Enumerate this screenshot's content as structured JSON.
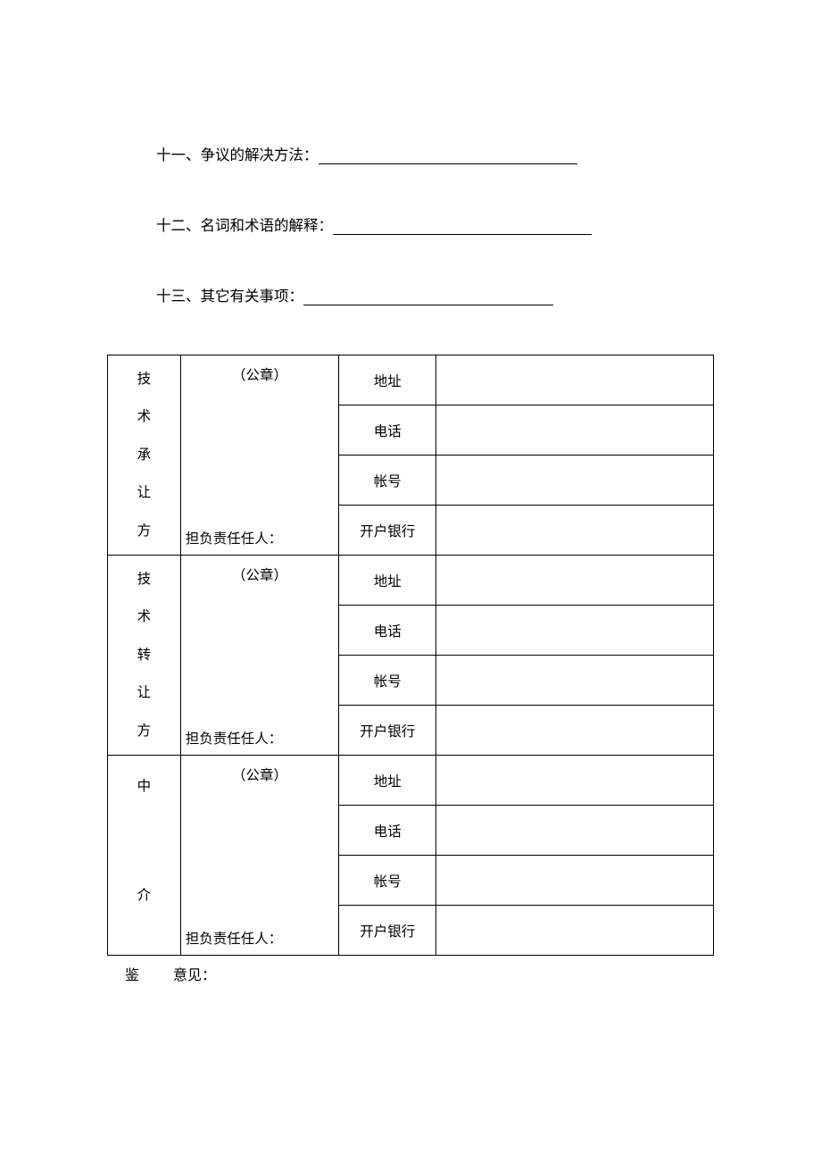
{
  "clauses": {
    "c11": "十一、争议的解决方法：",
    "c12": "十二、名词和术语的解释：",
    "c13": "十三、其它有关事项："
  },
  "parties": [
    {
      "name_chars": [
        "技",
        "术",
        "承",
        "让",
        "方"
      ],
      "seal": "（公章）",
      "responsible": "担负责任任人：",
      "rows": [
        "地址",
        "电话",
        "帐号",
        "开户银行"
      ]
    },
    {
      "name_chars": [
        "技",
        "术",
        "转",
        "让",
        "方"
      ],
      "seal": "（公章）",
      "responsible": "担负责任任人：",
      "rows": [
        "地址",
        "电话",
        "帐号",
        "开户银行"
      ]
    },
    {
      "name_chars": [
        "中",
        "",
        "",
        "介",
        ""
      ],
      "seal": "（公章）",
      "responsible": "担负责任任人：",
      "rows": [
        "地址",
        "电话",
        "帐号",
        "开户银行"
      ]
    }
  ],
  "footer": {
    "part1": "鉴",
    "part2": "意见："
  }
}
